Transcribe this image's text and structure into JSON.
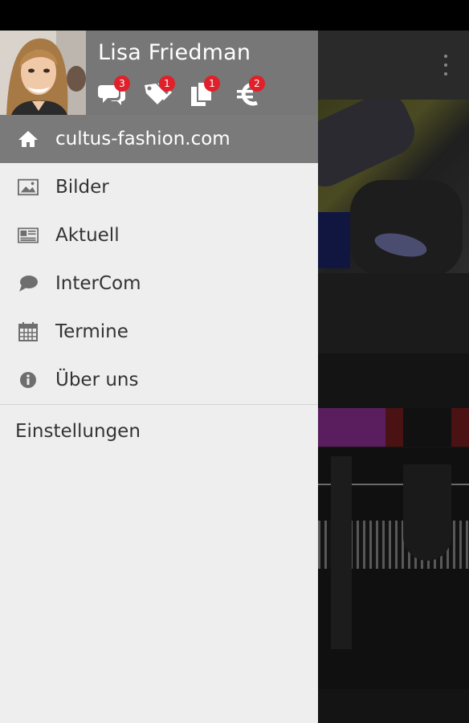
{
  "user": {
    "name": "Lisa Friedman",
    "avatar": "profile-photo"
  },
  "header_icons": [
    {
      "icon": "chat-bubbles-icon",
      "badge": "3"
    },
    {
      "icon": "tags-icon",
      "badge": "1"
    },
    {
      "icon": "pages-icon",
      "badge": "1"
    },
    {
      "icon": "euro-icon",
      "badge": "2"
    }
  ],
  "nav": {
    "items": [
      {
        "label": "cultus-fashion.com",
        "icon": "home-icon",
        "active": true
      },
      {
        "label": "Bilder",
        "icon": "image-icon",
        "active": false
      },
      {
        "label": "Aktuell",
        "icon": "newspaper-icon",
        "active": false
      },
      {
        "label": "InterCom",
        "icon": "speech-bubble-icon",
        "active": false
      },
      {
        "label": "Termine",
        "icon": "calendar-icon",
        "active": false
      },
      {
        "label": "Über uns",
        "icon": "info-icon",
        "active": false
      }
    ],
    "settings_label": "Einstellungen"
  },
  "colors": {
    "drawer_bg": "#eeeeee",
    "header_bg": "#777777",
    "active_item_bg": "#7a7a7a",
    "badge": "#e0202a",
    "text": "#333333"
  }
}
